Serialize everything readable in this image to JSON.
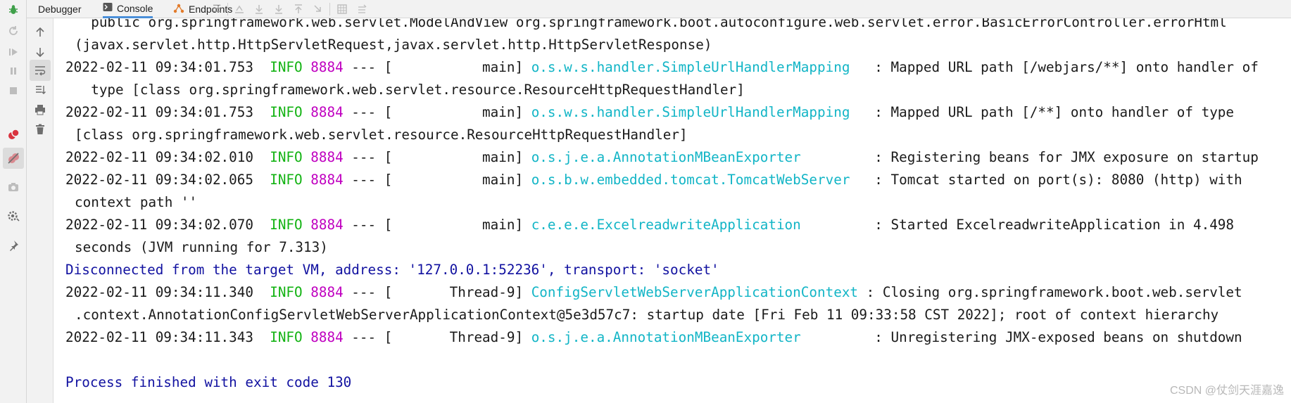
{
  "tabs": {
    "debugger": "Debugger",
    "console": "Console",
    "endpoints": "Endpoints"
  },
  "colors": {
    "info": "#13b313",
    "pid": "#c000c0",
    "logger": "#12b5c6",
    "system_message": "#1111a0",
    "active_tab_underline": "#4a8fd9"
  },
  "console": {
    "lines": [
      {
        "kind": "text",
        "text": "  public org.springframework.web.servlet.ModelAndView org.springframework.boot.autoconfigure.web.servlet.error.BasicErrorController.errorHtml"
      },
      {
        "kind": "text",
        "text": "(javax.servlet.http.HttpServletRequest,javax.servlet.http.HttpServletResponse)"
      },
      {
        "kind": "log",
        "ts": "2022-02-11 09:34:01.753",
        "level": "INFO",
        "pid": "8884",
        "sep": " --- [",
        "thread": "           main]",
        "logger": "o.s.w.s.handler.SimpleUrlHandlerMapping ",
        "msg": "  : Mapped URL path [/webjars/**] onto handler of"
      },
      {
        "kind": "text",
        "text": "  type [class org.springframework.web.servlet.resource.ResourceHttpRequestHandler]"
      },
      {
        "kind": "log",
        "ts": "2022-02-11 09:34:01.753",
        "level": "INFO",
        "pid": "8884",
        "sep": " --- [",
        "thread": "           main]",
        "logger": "o.s.w.s.handler.SimpleUrlHandlerMapping ",
        "msg": "  : Mapped URL path [/**] onto handler of type"
      },
      {
        "kind": "text",
        "text": "[class org.springframework.web.servlet.resource.ResourceHttpRequestHandler]"
      },
      {
        "kind": "log",
        "ts": "2022-02-11 09:34:02.010",
        "level": "INFO",
        "pid": "8884",
        "sep": " --- [",
        "thread": "           main]",
        "logger": "o.s.j.e.a.AnnotationMBeanExporter       ",
        "msg": "  : Registering beans for JMX exposure on startup"
      },
      {
        "kind": "log",
        "ts": "2022-02-11 09:34:02.065",
        "level": "INFO",
        "pid": "8884",
        "sep": " --- [",
        "thread": "           main]",
        "logger": "o.s.b.w.embedded.tomcat.TomcatWebServer ",
        "msg": "  : Tomcat started on port(s): 8080 (http) with"
      },
      {
        "kind": "text",
        "text": "context path ''"
      },
      {
        "kind": "log",
        "ts": "2022-02-11 09:34:02.070",
        "level": "INFO",
        "pid": "8884",
        "sep": " --- [",
        "thread": "           main]",
        "logger": "c.e.e.e.ExcelreadwriteApplication       ",
        "msg": "  : Started ExcelreadwriteApplication in 4.498"
      },
      {
        "kind": "text",
        "text": "seconds (JVM running for 7.313)"
      },
      {
        "kind": "sys",
        "text": "Disconnected from the target VM, address: '127.0.0.1:52236', transport: 'socket'"
      },
      {
        "kind": "log",
        "ts": "2022-02-11 09:34:11.340",
        "level": "INFO",
        "pid": "8884",
        "sep": " --- [",
        "thread": "       Thread-9]",
        "logger": "ConfigServletWebServerApplicationContext",
        "msg": " : Closing org.springframework.boot.web.servlet"
      },
      {
        "kind": "text",
        "text": ".context.AnnotationConfigServletWebServerApplicationContext@5e3d57c7: startup date [Fri Feb 11 09:33:58 CST 2022]; root of context hierarchy"
      },
      {
        "kind": "log",
        "ts": "2022-02-11 09:34:11.343",
        "level": "INFO",
        "pid": "8884",
        "sep": " --- [",
        "thread": "       Thread-9]",
        "logger": "o.s.j.e.a.AnnotationMBeanExporter       ",
        "msg": "  : Unregistering JMX-exposed beans on shutdown"
      },
      {
        "kind": "blank",
        "text": ""
      },
      {
        "kind": "sys",
        "text": "Process finished with exit code 130"
      }
    ]
  },
  "watermark": "CSDN @仗剑天涯嘉逸"
}
